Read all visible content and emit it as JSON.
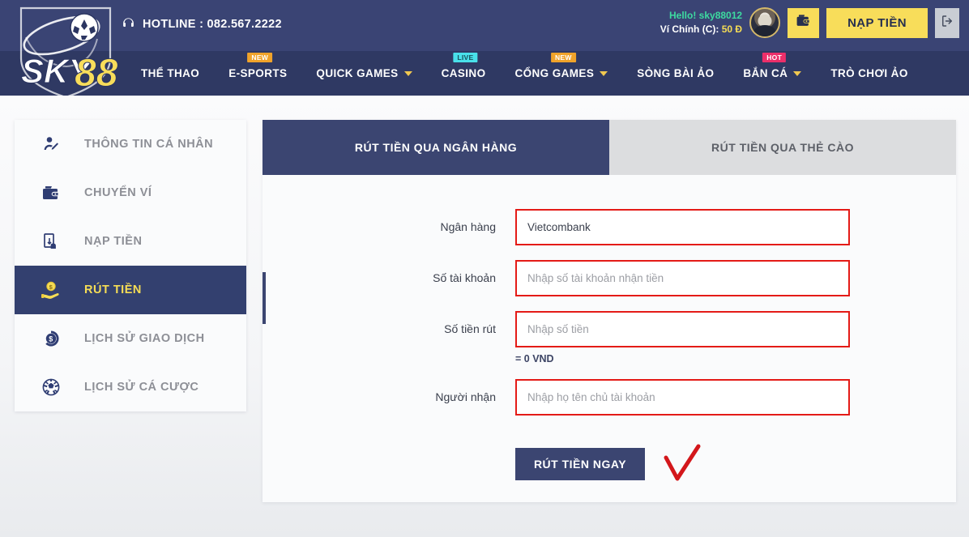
{
  "header": {
    "logo_main": "SKY",
    "logo_accent": "88",
    "hotline_label": "HOTLINE : 082.567.2222",
    "hotline_icon": "headset-icon",
    "user": {
      "greeting": "Hello! sky88012",
      "greeting_prefix": "Hello!",
      "username": "sky88012",
      "wallet_label": "Ví Chính (C):",
      "wallet_amount": "50 Đ",
      "avatar_icon": "user-avatar",
      "wallet_button_icon": "wallet-icon",
      "deposit_label": "NẠP TIỀN",
      "logout_icon": "logout-icon"
    },
    "nav": [
      {
        "label": "THỂ THAO",
        "badge": "",
        "caret": false
      },
      {
        "label": "E-SPORTS",
        "badge": "NEW",
        "badge_type": "new",
        "caret": false
      },
      {
        "label": "QUICK GAMES",
        "badge": "",
        "caret": true
      },
      {
        "label": "CASINO",
        "badge": "LIVE",
        "badge_type": "live",
        "caret": false
      },
      {
        "label": "CỔNG GAMES",
        "badge": "NEW",
        "badge_type": "new",
        "caret": true
      },
      {
        "label": "SÒNG BÀI ẢO",
        "badge": "",
        "caret": false
      },
      {
        "label": "BẮN CÁ",
        "badge": "HOT",
        "badge_type": "hot",
        "caret": true
      },
      {
        "label": "TRÒ CHƠI ẢO",
        "badge": "",
        "caret": false
      }
    ]
  },
  "sidebar": {
    "items": [
      {
        "label": "THÔNG TIN CÁ NHÂN",
        "icon": "user-profile-icon",
        "active": false
      },
      {
        "label": "CHUYỂN VÍ",
        "icon": "wallet-icon",
        "active": false
      },
      {
        "label": "NẠP TIỀN",
        "icon": "deposit-hand-icon",
        "active": false
      },
      {
        "label": "RÚT TIỀN",
        "icon": "withdraw-coin-hand-icon",
        "active": true
      },
      {
        "label": "LỊCH SỬ GIAO DỊCH",
        "icon": "coin-history-icon",
        "active": false
      },
      {
        "label": "LỊCH SỬ CÁ CƯỢC",
        "icon": "football-icon",
        "active": false
      }
    ]
  },
  "main": {
    "tabs": [
      {
        "label": "RÚT TIỀN QUA NGÂN HÀNG",
        "active": true
      },
      {
        "label": "RÚT TIỀN QUA THẺ CÀO",
        "active": false
      }
    ],
    "form": {
      "bank": {
        "label": "Ngân hàng",
        "value": "Vietcombank",
        "placeholder": ""
      },
      "account_number": {
        "label": "Số tài khoản",
        "value": "",
        "placeholder": "Nhập số tài khoản nhận tiền"
      },
      "amount": {
        "label": "Số tiền rút",
        "value": "",
        "placeholder": "Nhập số tiền",
        "hint": "= 0 VND"
      },
      "recipient": {
        "label": "Người nhận",
        "value": "",
        "placeholder": "Nhập họ tên chủ tài khoản"
      },
      "submit_label": "RÚT TIỀN NGAY",
      "annotation_icon": "red-checkmark-annotation"
    }
  },
  "colors": {
    "header_top": "#3a4474",
    "header_nav": "#2f3963",
    "accent_blue": "#3b4571",
    "accent_yellow": "#f8dd5a",
    "field_border_red": "#e41b17",
    "greeting_green": "#3ddba0",
    "badge_new": "#f0a32a",
    "badge_live": "#49e0ea",
    "badge_hot": "#ec2f6a"
  }
}
